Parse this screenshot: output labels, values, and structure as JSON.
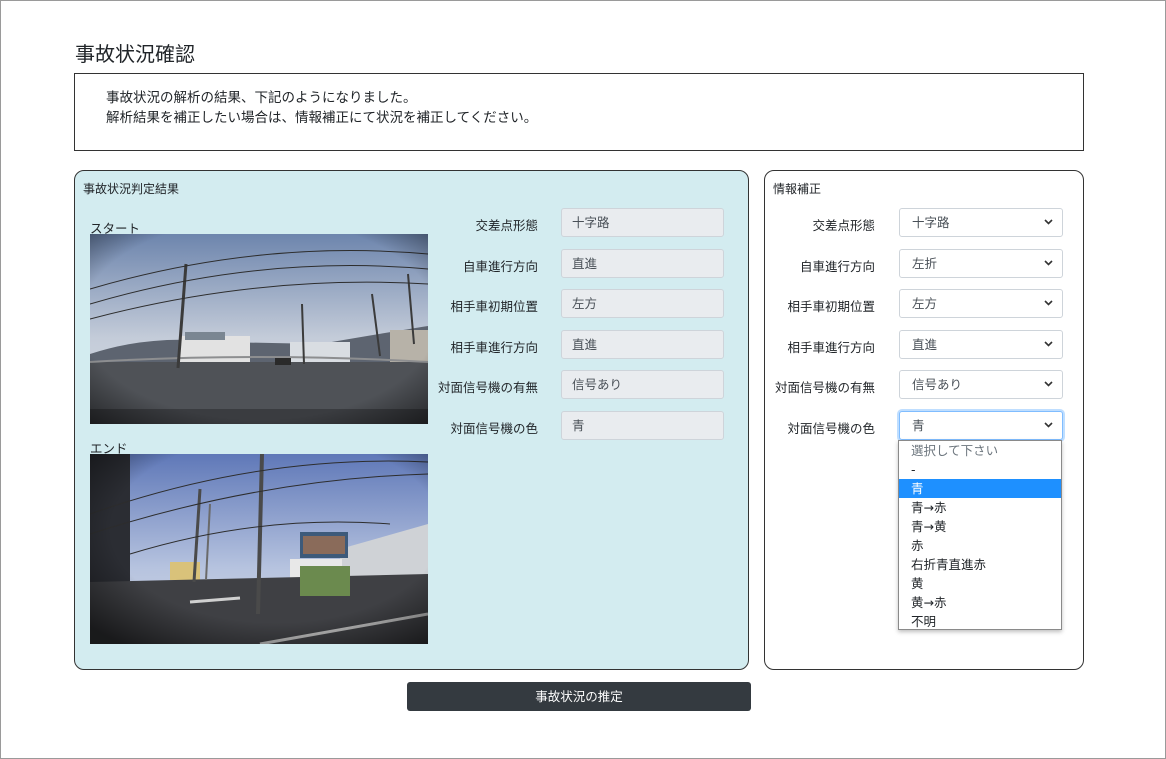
{
  "page_title": "事故状況確認",
  "notice": {
    "line1": "事故状況の解析の結果、下記のようになりました。",
    "line2": "解析結果を補正したい場合は、情報補正にて状況を補正してください。"
  },
  "result_panel": {
    "title": "事故状況判定結果",
    "start_label": "スタート",
    "end_label": "エンド",
    "fields": [
      {
        "label": "交差点形態",
        "value": "十字路"
      },
      {
        "label": "自車進行方向",
        "value": "直進"
      },
      {
        "label": "相手車初期位置",
        "value": "左方"
      },
      {
        "label": "相手車進行方向",
        "value": "直進"
      },
      {
        "label": "対面信号機の有無",
        "value": "信号あり"
      },
      {
        "label": "対面信号機の色",
        "value": "青"
      }
    ]
  },
  "correction_panel": {
    "title": "情報補正",
    "fields": [
      {
        "label": "交差点形態",
        "value": "十字路"
      },
      {
        "label": "自車進行方向",
        "value": "左折"
      },
      {
        "label": "相手車初期位置",
        "value": "左方"
      },
      {
        "label": "相手車進行方向",
        "value": "直進"
      },
      {
        "label": "対面信号機の有無",
        "value": "信号あり"
      },
      {
        "label": "対面信号機の色",
        "value": "青"
      }
    ],
    "signal_color_options": [
      "選択して下さい",
      "-",
      "青",
      "青→赤",
      "青→黄",
      "赤",
      "右折青直進赤",
      "黄",
      "黄→赤",
      "不明"
    ],
    "selected_option": "青"
  },
  "submit_label": "事故状況の推定",
  "colors": {
    "result_panel_bg": "#d3ecf0",
    "selected_option_bg": "#1e90ff",
    "button_bg": "#343a40"
  },
  "icons": [
    "chevron-down-icon"
  ]
}
